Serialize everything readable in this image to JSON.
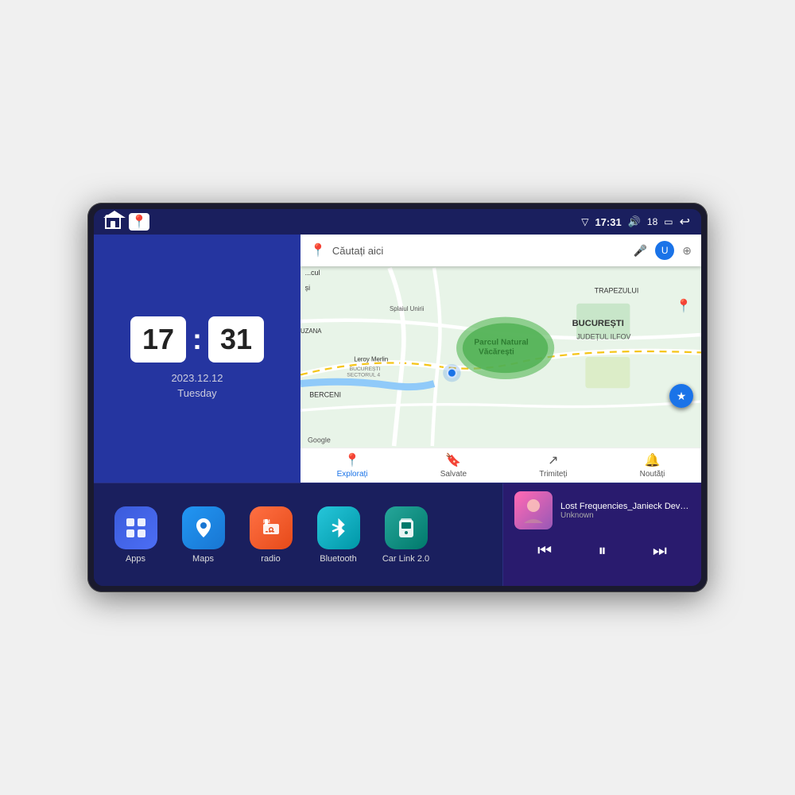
{
  "device": {
    "status_bar": {
      "left_icons": [
        "home",
        "maps-pin"
      ],
      "time": "17:31",
      "signal_icon": "▽",
      "volume_icon": "🔊",
      "battery_level": "18",
      "battery_icon": "🔋",
      "back_icon": "↩"
    },
    "clock": {
      "hours": "17",
      "minutes": "31",
      "date": "2023.12.12",
      "day": "Tuesday"
    },
    "map": {
      "search_placeholder": "Căutați aici",
      "nav_items": [
        {
          "label": "Explorați",
          "active": true
        },
        {
          "label": "Salvate",
          "active": false
        },
        {
          "label": "Trimiteți",
          "active": false
        },
        {
          "label": "Noutăți",
          "active": false
        }
      ],
      "location_names": [
        "Parcul Natural Văcărești",
        "BUCUREȘTI",
        "JUDEȚUL ILFOV",
        "TRAPEZULUI",
        "BERCENI",
        "Leroy Merlin",
        "BUCUREȘTI SECTORUL 4",
        "Splaiul Unirii"
      ]
    },
    "apps": [
      {
        "id": "apps",
        "label": "Apps",
        "icon": "⊞",
        "bg": "apps-bg"
      },
      {
        "id": "maps",
        "label": "Maps",
        "icon": "🗺",
        "bg": "maps-bg"
      },
      {
        "id": "radio",
        "label": "radio",
        "icon": "📻",
        "bg": "radio-bg"
      },
      {
        "id": "bluetooth",
        "label": "Bluetooth",
        "icon": "🔷",
        "bg": "bt-bg"
      },
      {
        "id": "carlink",
        "label": "Car Link 2.0",
        "icon": "📱",
        "bg": "carlink-bg"
      }
    ],
    "music": {
      "title": "Lost Frequencies_Janieck Devy-...",
      "artist": "Unknown",
      "controls": {
        "prev": "⏮",
        "play": "⏸",
        "next": "⏭"
      }
    }
  }
}
